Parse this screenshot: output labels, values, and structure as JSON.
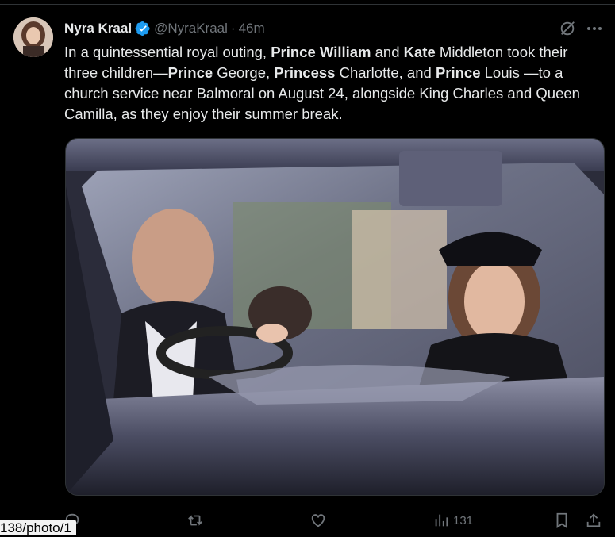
{
  "tweet": {
    "author_name": "Nyra Kraal",
    "handle": "@NyraKraal",
    "separator": "·",
    "time": "46m",
    "text_segments": [
      {
        "t": "In a quintessential royal outing, ",
        "b": false
      },
      {
        "t": "Prince William",
        "b": true
      },
      {
        "t": " and ",
        "b": false
      },
      {
        "t": "Kate",
        "b": true
      },
      {
        "t": " Middleton took their three children—",
        "b": false
      },
      {
        "t": "Prince",
        "b": true
      },
      {
        "t": " George, ",
        "b": false
      },
      {
        "t": "Princess",
        "b": true
      },
      {
        "t": " Charlotte, and ",
        "b": false
      },
      {
        "t": "Prince",
        "b": true
      },
      {
        "t": " Louis —to a church service near Balmoral on August 24, alongside King Charles and Queen Camilla, as they enjoy their summer break.",
        "b": false
      }
    ]
  },
  "actions": {
    "reply_count": "",
    "retweet_count": "",
    "like_count": "",
    "views_count": "131"
  },
  "status_url_tip": "138/photo/1",
  "colors": {
    "background": "#000000",
    "text": "#e7e9ea",
    "muted": "#71767b",
    "verified": "#1d9bf0"
  },
  "icons": [
    "verified-badge-icon",
    "grok-icon",
    "more-icon",
    "reply-icon",
    "retweet-icon",
    "like-icon",
    "views-icon",
    "bookmark-icon",
    "share-icon"
  ]
}
